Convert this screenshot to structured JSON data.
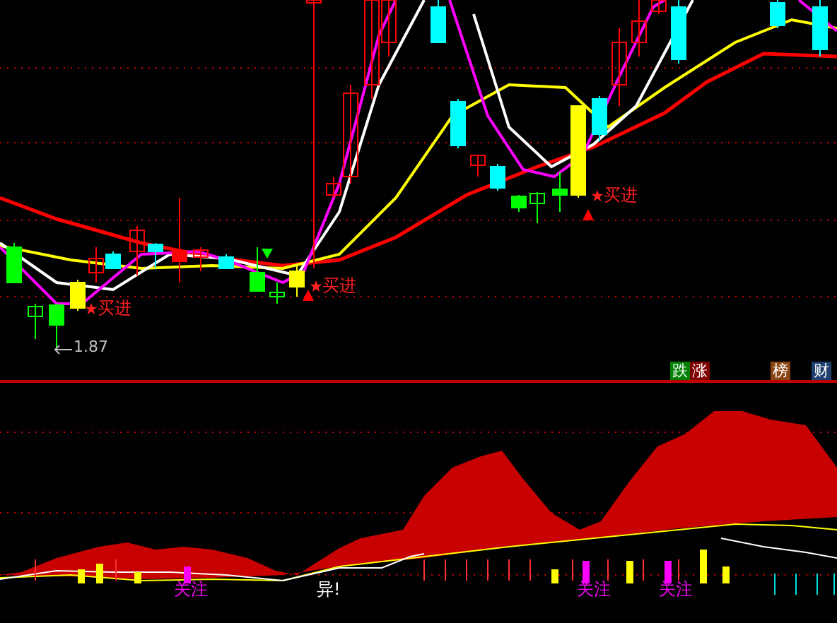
{
  "main_chart": {
    "signals": [
      {
        "label": "买进"
      },
      {
        "label": "买进"
      },
      {
        "label": "买进"
      }
    ],
    "low_marker": "1.87"
  },
  "badges": [
    {
      "label": "跌",
      "color": "#008000"
    },
    {
      "label": "涨",
      "color": "#800000"
    },
    {
      "label": "榜",
      "color": "#8b4513"
    },
    {
      "label": "财",
      "color": "#1f3f6f"
    }
  ],
  "indicator": {
    "signals": [
      {
        "label": "关注"
      },
      {
        "label": "关注"
      },
      {
        "label": "关注"
      }
    ],
    "alert": "异!"
  }
}
